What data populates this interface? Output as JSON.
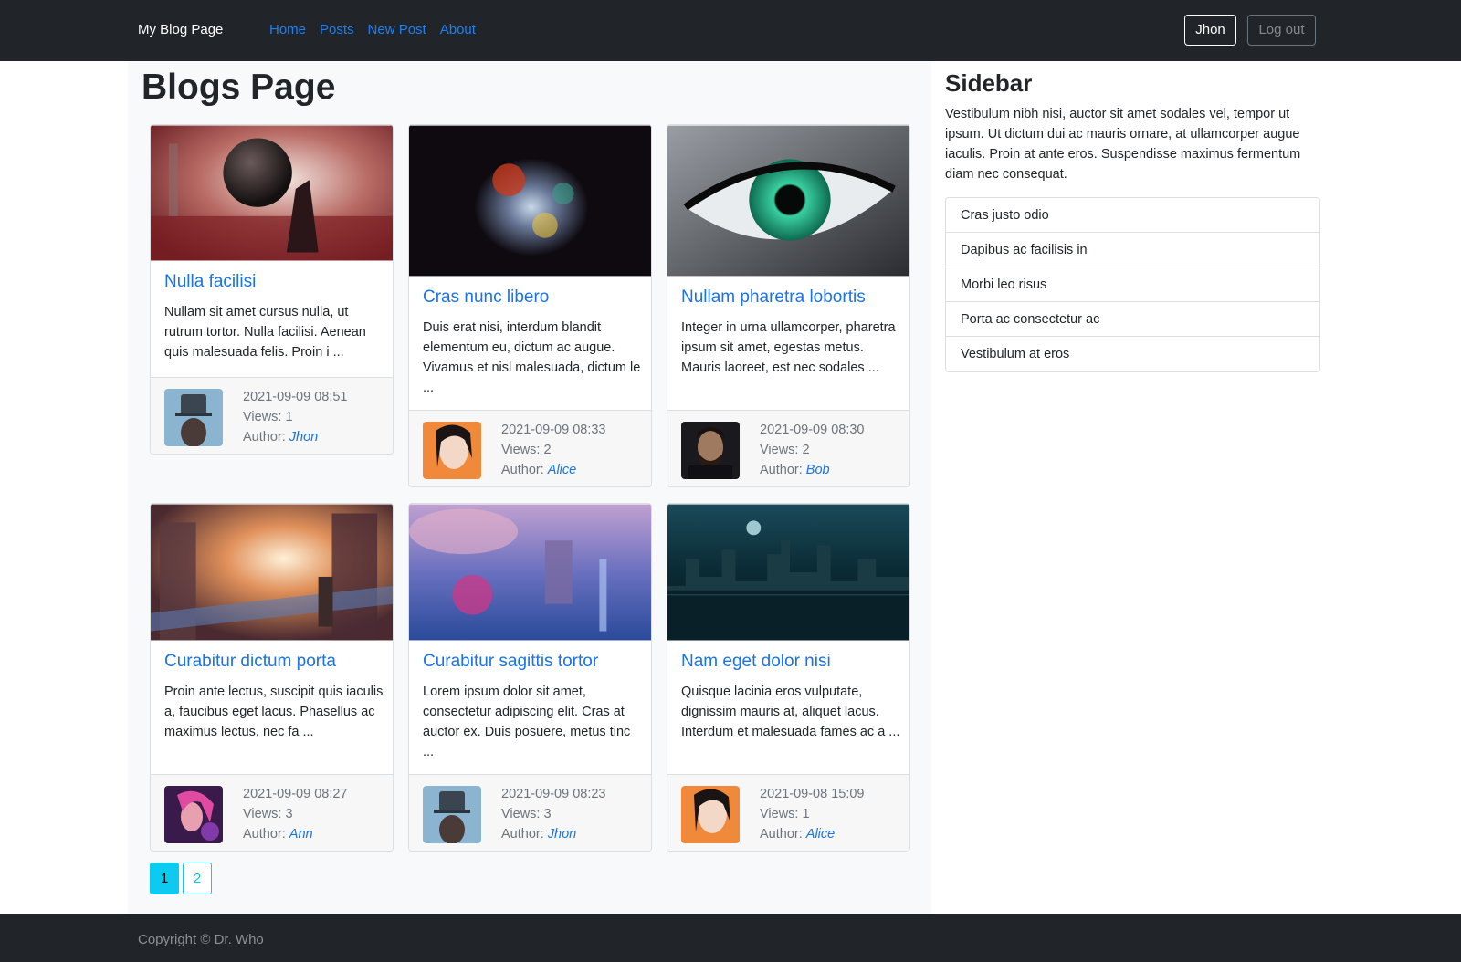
{
  "navbar": {
    "brand": "My Blog Page",
    "links": [
      "Home",
      "Posts",
      "New Post",
      "About"
    ],
    "user_button": "Jhon",
    "logout_button": "Log out"
  },
  "main": {
    "title": "Blogs Page",
    "posts": [
      {
        "title": "Nulla facilisi",
        "excerpt": "Nullam sit amet cursus nulla, ut rutrum tortor. Nulla facilisi. Aenean quis malesuada felis. Proin i ...",
        "date": "2021-09-09 08:51",
        "views": "Views: 1",
        "author_label": "Author: ",
        "author": "Jhon"
      },
      {
        "title": "Cras nunc libero",
        "excerpt": "Duis erat nisi, interdum blandit elementum eu, dictum ac augue. Vivamus et nisl malesuada, dictum le ...",
        "date": "2021-09-09 08:33",
        "views": "Views: 2",
        "author_label": "Author: ",
        "author": "Alice"
      },
      {
        "title": "Nullam pharetra lobortis",
        "excerpt": "Integer in urna ullamcorper, pharetra ipsum sit amet, egestas metus. Mauris laoreet, est nec sodales ...",
        "date": "2021-09-09 08:30",
        "views": "Views: 2",
        "author_label": "Author: ",
        "author": "Bob"
      },
      {
        "title": "Curabitur dictum porta",
        "excerpt": "Proin ante lectus, suscipit quis iaculis a, faucibus eget lacus. Phasellus ac maximus lectus, nec fa ...",
        "date": "2021-09-09 08:27",
        "views": "Views: 3",
        "author_label": "Author: ",
        "author": "Ann"
      },
      {
        "title": "Curabitur sagittis tortor",
        "excerpt": "Lorem ipsum dolor sit amet, consectetur adipiscing elit. Cras at auctor ex. Duis posuere, metus tinc ...",
        "date": "2021-09-09 08:23",
        "views": "Views: 3",
        "author_label": "Author: ",
        "author": "Jhon"
      },
      {
        "title": "Nam eget dolor nisi",
        "excerpt": "Quisque lacinia eros vulputate, dignissim mauris at, aliquet lacus. Interdum et malesuada fames ac a ...",
        "date": "2021-09-08 15:09",
        "views": "Views: 1",
        "author_label": "Author: ",
        "author": "Alice"
      }
    ],
    "pagination": [
      "1",
      "2"
    ],
    "current_page": "1"
  },
  "sidebar": {
    "title": "Sidebar",
    "text": "Vestibulum nibh nisi, auctor sit amet sodales vel, tempor ut ipsum. Ut dictum dui ac mauris ornare, at ullamcorper augue iaculis. Proin at ante eros. Suspendisse maximus fermentum diam nec consequat.",
    "items": [
      "Cras justo odio",
      "Dapibus ac facilisis in",
      "Morbi leo risus",
      "Porta ac consectetur ac",
      "Vestibulum at eros"
    ]
  },
  "footer": {
    "copyright": "Copyright © Dr. Who"
  },
  "colors": {
    "navbar_bg": "#212529",
    "link": "#1a73e8",
    "pagination_accent": "#0dcaf0",
    "main_bg": "#f8f9fa"
  }
}
